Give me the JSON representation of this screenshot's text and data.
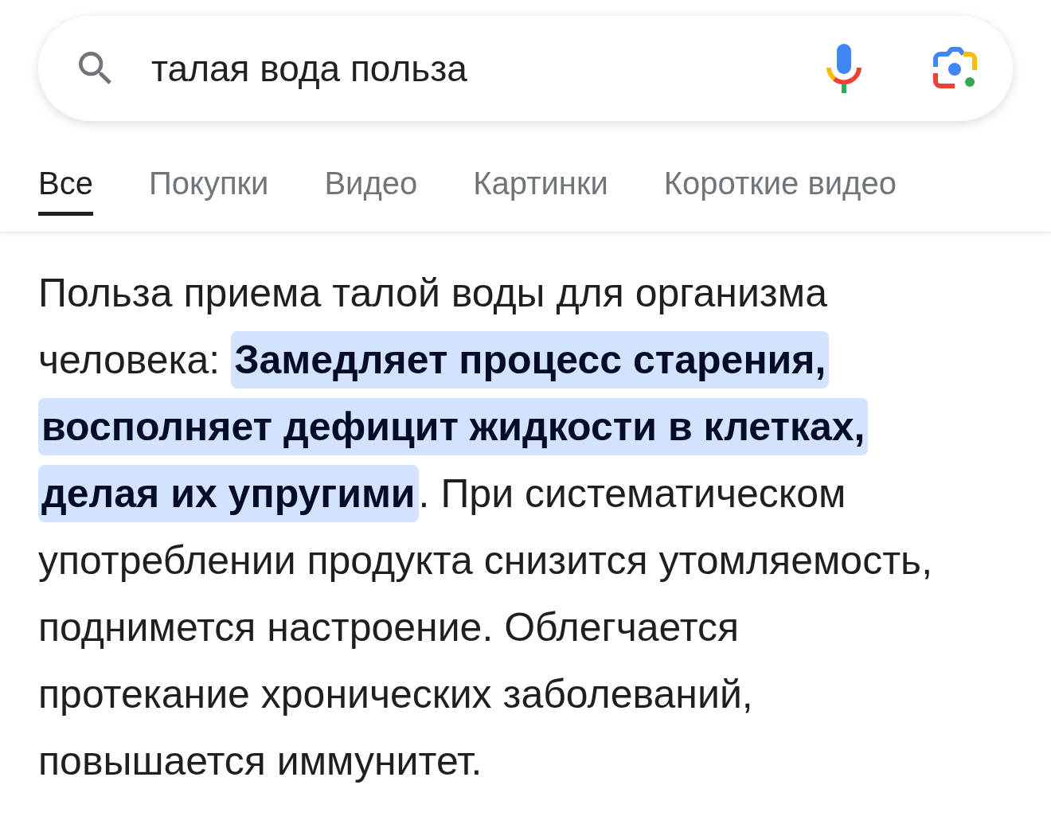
{
  "search": {
    "value": "талая вода польза"
  },
  "tabs": [
    {
      "label": "Все",
      "selected": true
    },
    {
      "label": "Покупки",
      "selected": false
    },
    {
      "label": "Видео",
      "selected": false
    },
    {
      "label": "Картинки",
      "selected": false
    },
    {
      "label": "Короткие видео",
      "selected": false
    }
  ],
  "answer": {
    "text": "Польза приема талой воды для организма человека: **Замедляет процесс старения, восполняет дефицит жидкости в клетках, делая их упругими**. При систематическом употреблении продукта снизится утомляемость, поднимется настроение. Облегчается протекание хронических заболеваний, повышается иммунитет."
  }
}
